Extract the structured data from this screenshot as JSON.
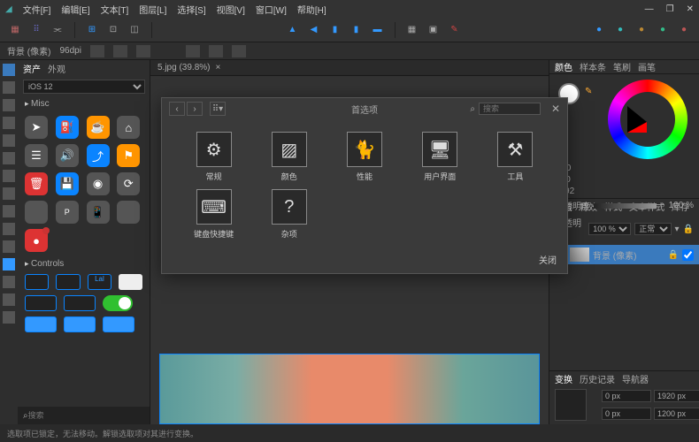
{
  "menu": {
    "file": "文件[F]",
    "edit": "编辑[E]",
    "text": "文本[T]",
    "layer": "图层[L]",
    "select": "选择[S]",
    "view": "视图[V]",
    "window": "窗口[W]",
    "help": "帮助[H]"
  },
  "status": {
    "layer": "背景 (像素)",
    "dpi": "96dpi"
  },
  "asset": {
    "tab_asset": "资产",
    "tab_appearance": "外观",
    "preset": "iOS 12",
    "section_misc": "Misc",
    "section_controls": "Controls",
    "btn_label": "Lal"
  },
  "canvas": {
    "tab": "5.jpg (39.8%)"
  },
  "right": {
    "tab_color": "颜色",
    "tab_swatch": "样本条",
    "tab_brush": "笔刷",
    "tab_brushes": "画笔",
    "h": "H: 0",
    "s": "S: 0",
    "l": "L: 92",
    "opacity_label": "不透明度",
    "opacity_val": "100 %",
    "layers_tab": "图层",
    "fx": "特效",
    "styles": "样式",
    "textstyles": "文本样式",
    "stock": "库存",
    "lopacity": "不透明度",
    "lopacity_val": "100 %",
    "blend": "正常",
    "layer_name": "背景 (像素)",
    "xform": "变换",
    "history": "历史记录",
    "nav": "导航器",
    "x": "0 px",
    "y": "0 px",
    "w": "1920 px",
    "h2": "1200 px"
  },
  "search": {
    "icon": "⌕",
    "placeholder": "搜索"
  },
  "footer": "选取项已锁定，无法移动。解锁选取项对其进行变换。",
  "dialog": {
    "title": "首选项",
    "search_placeholder": "搜索",
    "close": "关闭",
    "items": [
      {
        "icon": "⚙",
        "label": "常规"
      },
      {
        "icon": "▨",
        "label": "颜色"
      },
      {
        "icon": "🐈",
        "label": "性能"
      },
      {
        "icon": "🖥",
        "label": "用户界面"
      },
      {
        "icon": "⚒",
        "label": "工具"
      },
      {
        "icon": "⌨",
        "label": "键盘快捷键"
      },
      {
        "icon": "?",
        "label": "杂项"
      }
    ]
  }
}
